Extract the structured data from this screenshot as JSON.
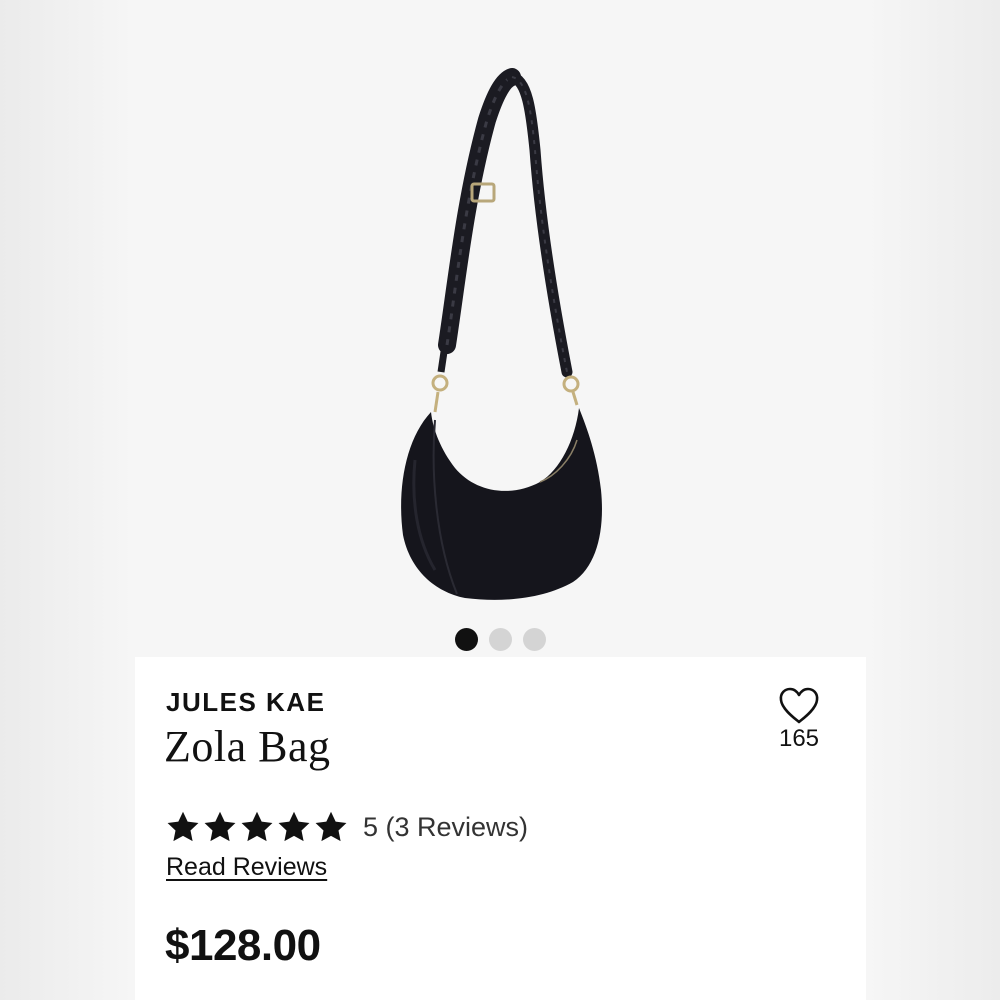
{
  "gallery": {
    "image_subject": "black crescent shoulder bag with braided strap",
    "dots": [
      {
        "active": true
      },
      {
        "active": false
      },
      {
        "active": false
      }
    ]
  },
  "product": {
    "brand": "JULES KAE",
    "name": "Zola Bag",
    "price": "$128.00",
    "rating": {
      "stars": 5,
      "text": "5 (3 Reviews)",
      "read_reviews_label": "Read Reviews"
    },
    "favorite": {
      "icon": "heart-outline-icon",
      "count": "165"
    }
  },
  "colors": {
    "text": "#111111",
    "gallery_bg": "#f6f6f6",
    "dot_active": "#111111",
    "dot_inactive": "#d4d4d4",
    "bag": "#15151c"
  }
}
